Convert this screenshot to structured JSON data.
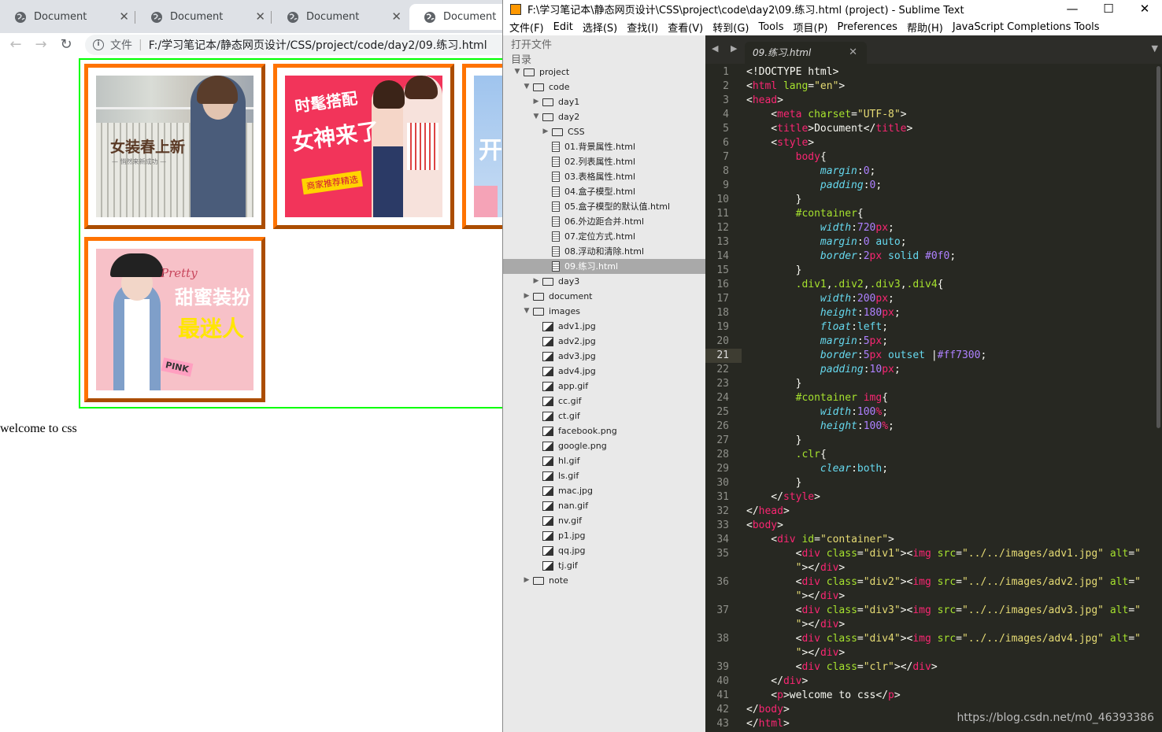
{
  "browser": {
    "tabs": [
      {
        "title": "Document"
      },
      {
        "title": "Document"
      },
      {
        "title": "Document"
      },
      {
        "title": "Document"
      }
    ],
    "url_scheme": "文件",
    "url": "F:/学习笔记本/静态网页设计/CSS/project/code/day2/09.练习.html",
    "images": {
      "img1_caption": "女装春上新",
      "img1_sub": "— 悄然来新成功 —",
      "img2_caption": "时髦搭配",
      "img2_caption2": "女神来了",
      "img2_tag": "商家推荐精选",
      "img3_caption": "开",
      "img4_caption": "甜蜜装扮",
      "img4_caption2": "最迷人",
      "img4_script": "Pretty",
      "img4_bag": "PINK"
    },
    "welcome": "welcome to css"
  },
  "sublime": {
    "title": "F:\\学习笔记本\\静态网页设计\\CSS\\project\\code\\day2\\09.练习.html (project) - Sublime Text",
    "menu": [
      "文件(F)",
      "Edit",
      "选择(S)",
      "查找(I)",
      "查看(V)",
      "转到(G)",
      "Tools",
      "项目(P)",
      "Preferences",
      "帮助(H)",
      "JavaScript Completions Tools"
    ],
    "sidebar": {
      "open_files": "打开文件",
      "folders": "目录",
      "tree": [
        {
          "label": "project",
          "type": "folder",
          "open": true,
          "level": 0
        },
        {
          "label": "code",
          "type": "folder",
          "open": true,
          "level": 1
        },
        {
          "label": "day1",
          "type": "folder",
          "open": false,
          "level": 2
        },
        {
          "label": "day2",
          "type": "folder",
          "open": true,
          "level": 2
        },
        {
          "label": "CSS",
          "type": "folder",
          "open": false,
          "level": 3
        },
        {
          "label": "01.背景属性.html",
          "type": "file",
          "level": 3
        },
        {
          "label": "02.列表属性.html",
          "type": "file",
          "level": 3
        },
        {
          "label": "03.表格属性.html",
          "type": "file",
          "level": 3
        },
        {
          "label": "04.盒子模型.html",
          "type": "file",
          "level": 3
        },
        {
          "label": "05.盒子模型的默认值.html",
          "type": "file",
          "level": 3
        },
        {
          "label": "06.外边距合并.html",
          "type": "file",
          "level": 3
        },
        {
          "label": "07.定位方式.html",
          "type": "file",
          "level": 3
        },
        {
          "label": "08.浮动和清除.html",
          "type": "file",
          "level": 3
        },
        {
          "label": "09.练习.html",
          "type": "file",
          "level": 3,
          "selected": true
        },
        {
          "label": "day3",
          "type": "folder",
          "open": false,
          "level": 2
        },
        {
          "label": "document",
          "type": "folder",
          "open": false,
          "level": 1
        },
        {
          "label": "images",
          "type": "folder",
          "open": true,
          "level": 1
        },
        {
          "label": "adv1.jpg",
          "type": "image",
          "level": 2
        },
        {
          "label": "adv2.jpg",
          "type": "image",
          "level": 2
        },
        {
          "label": "adv3.jpg",
          "type": "image",
          "level": 2
        },
        {
          "label": "adv4.jpg",
          "type": "image",
          "level": 2
        },
        {
          "label": "app.gif",
          "type": "image",
          "level": 2
        },
        {
          "label": "cc.gif",
          "type": "image",
          "level": 2
        },
        {
          "label": "ct.gif",
          "type": "image",
          "level": 2
        },
        {
          "label": "facebook.png",
          "type": "image",
          "level": 2
        },
        {
          "label": "google.png",
          "type": "image",
          "level": 2
        },
        {
          "label": "hl.gif",
          "type": "image",
          "level": 2
        },
        {
          "label": "ls.gif",
          "type": "image",
          "level": 2
        },
        {
          "label": "mac.jpg",
          "type": "image",
          "level": 2
        },
        {
          "label": "nan.gif",
          "type": "image",
          "level": 2
        },
        {
          "label": "nv.gif",
          "type": "image",
          "level": 2
        },
        {
          "label": "p1.jpg",
          "type": "image",
          "level": 2
        },
        {
          "label": "qq.jpg",
          "type": "image",
          "level": 2
        },
        {
          "label": "tj.gif",
          "type": "image",
          "level": 2
        },
        {
          "label": "note",
          "type": "folder",
          "open": false,
          "level": 1
        }
      ]
    },
    "editor_tab": "09.练习.html",
    "current_line": 21,
    "code_lines": [
      {
        "n": "1",
        "html": "&lt;!DOCTYPE html&gt;"
      },
      {
        "n": "2",
        "html": "&lt;<span class='t'>html</span> <span class='a'>lang</span>=<span class='s'>\"en\"</span>&gt;"
      },
      {
        "n": "3",
        "html": "&lt;<span class='t'>head</span>&gt;"
      },
      {
        "n": "4",
        "html": "    &lt;<span class='t'>meta</span> <span class='a'>charset</span>=<span class='s'>\"UTF-8\"</span>&gt;"
      },
      {
        "n": "5",
        "html": "    &lt;<span class='t'>title</span>&gt;Document&lt;/<span class='t'>title</span>&gt;"
      },
      {
        "n": "6",
        "html": "    &lt;<span class='t'>style</span>&gt;"
      },
      {
        "n": "7",
        "html": "        <span class='t'>body</span>{"
      },
      {
        "n": "8",
        "html": "            <span class='p'>margin</span>:<span class='n'>0</span>;"
      },
      {
        "n": "9",
        "html": "            <span class='p'>padding</span>:<span class='n'>0</span>;"
      },
      {
        "n": "10",
        "html": "        }"
      },
      {
        "n": "11",
        "html": "        <span class='a'>#container</span>{"
      },
      {
        "n": "12",
        "html": "            <span class='p'>width</span>:<span class='n'>720</span><span class='u'>px</span>;"
      },
      {
        "n": "13",
        "html": "            <span class='p'>margin</span>:<span class='n'>0</span> <span class='k'>auto</span>;"
      },
      {
        "n": "14",
        "html": "            <span class='p'>border</span>:<span class='n'>2</span><span class='u'>px</span> <span class='k'>solid</span> <span class='n'>#0f0</span>;"
      },
      {
        "n": "15",
        "html": "        }"
      },
      {
        "n": "16",
        "html": "        <span class='a'>.div1</span>,<span class='a'>.div2</span>,<span class='a'>.div3</span>,<span class='a'>.div4</span>{"
      },
      {
        "n": "17",
        "html": "            <span class='p'>width</span>:<span class='n'>200</span><span class='u'>px</span>;"
      },
      {
        "n": "18",
        "html": "            <span class='p'>height</span>:<span class='n'>180</span><span class='u'>px</span>;"
      },
      {
        "n": "19",
        "html": "            <span class='p'>float</span>:<span class='k'>left</span>;"
      },
      {
        "n": "20",
        "html": "            <span class='p'>margin</span>:<span class='n'>5</span><span class='u'>px</span>;"
      },
      {
        "n": "21",
        "html": "            <span class='p'>border</span>:<span class='n'>5</span><span class='u'>px</span> <span class='k'>outset</span> |<span class='n'>#ff7300</span>;"
      },
      {
        "n": "22",
        "html": "            <span class='p'>padding</span>:<span class='n'>10</span><span class='u'>px</span>;"
      },
      {
        "n": "23",
        "html": "        }"
      },
      {
        "n": "24",
        "html": "        <span class='a'>#container</span> <span class='t'>img</span>{"
      },
      {
        "n": "25",
        "html": "            <span class='p'>width</span>:<span class='n'>100</span><span class='u'>%</span>;"
      },
      {
        "n": "26",
        "html": "            <span class='p'>height</span>:<span class='n'>100</span><span class='u'>%</span>;"
      },
      {
        "n": "27",
        "html": "        }"
      },
      {
        "n": "28",
        "html": "        <span class='a'>.clr</span>{"
      },
      {
        "n": "29",
        "html": "            <span class='p'>clear</span>:<span class='k'>both</span>;"
      },
      {
        "n": "30",
        "html": "        }"
      },
      {
        "n": "31",
        "html": "    &lt;/<span class='t'>style</span>&gt;"
      },
      {
        "n": "32",
        "html": "&lt;/<span class='t'>head</span>&gt;"
      },
      {
        "n": "33",
        "html": "&lt;<span class='t'>body</span>&gt;"
      },
      {
        "n": "34",
        "html": "    &lt;<span class='t'>div</span> <span class='a'>id</span>=<span class='s'>\"container\"</span>&gt;"
      },
      {
        "n": "35",
        "html": "        &lt;<span class='t'>div</span> <span class='a'>class</span>=<span class='s'>\"div1\"</span>&gt;&lt;<span class='t'>img</span> <span class='a'>src</span>=<span class='s'>\"../../images/adv1.jpg\"</span> <span class='a'>alt</span>=<span class='s'>\"</span>"
      },
      {
        "n": "",
        "html": "        <span class='s'>\"</span>&gt;&lt;/<span class='t'>div</span>&gt;"
      },
      {
        "n": "36",
        "html": "        &lt;<span class='t'>div</span> <span class='a'>class</span>=<span class='s'>\"div2\"</span>&gt;&lt;<span class='t'>img</span> <span class='a'>src</span>=<span class='s'>\"../../images/adv2.jpg\"</span> <span class='a'>alt</span>=<span class='s'>\"</span>"
      },
      {
        "n": "",
        "html": "        <span class='s'>\"</span>&gt;&lt;/<span class='t'>div</span>&gt;"
      },
      {
        "n": "37",
        "html": "        &lt;<span class='t'>div</span> <span class='a'>class</span>=<span class='s'>\"div3\"</span>&gt;&lt;<span class='t'>img</span> <span class='a'>src</span>=<span class='s'>\"../../images/adv3.jpg\"</span> <span class='a'>alt</span>=<span class='s'>\"</span>"
      },
      {
        "n": "",
        "html": "        <span class='s'>\"</span>&gt;&lt;/<span class='t'>div</span>&gt;"
      },
      {
        "n": "38",
        "html": "        &lt;<span class='t'>div</span> <span class='a'>class</span>=<span class='s'>\"div4\"</span>&gt;&lt;<span class='t'>img</span> <span class='a'>src</span>=<span class='s'>\"../../images/adv4.jpg\"</span> <span class='a'>alt</span>=<span class='s'>\"</span>"
      },
      {
        "n": "",
        "html": "        <span class='s'>\"</span>&gt;&lt;/<span class='t'>div</span>&gt;"
      },
      {
        "n": "39",
        "html": "        &lt;<span class='t'>div</span> <span class='a'>class</span>=<span class='s'>\"clr\"</span>&gt;&lt;/<span class='t'>div</span>&gt;"
      },
      {
        "n": "40",
        "html": "    &lt;/<span class='t'>div</span>&gt;"
      },
      {
        "n": "41",
        "html": "    &lt;<span class='t'>p</span>&gt;welcome to css&lt;/<span class='t'>p</span>&gt;"
      },
      {
        "n": "42",
        "html": "&lt;/<span class='t'>body</span>&gt;"
      },
      {
        "n": "43",
        "html": "&lt;/<span class='t'>html</span>&gt;"
      }
    ],
    "watermark": "https://blog.csdn.net/m0_46393386"
  }
}
